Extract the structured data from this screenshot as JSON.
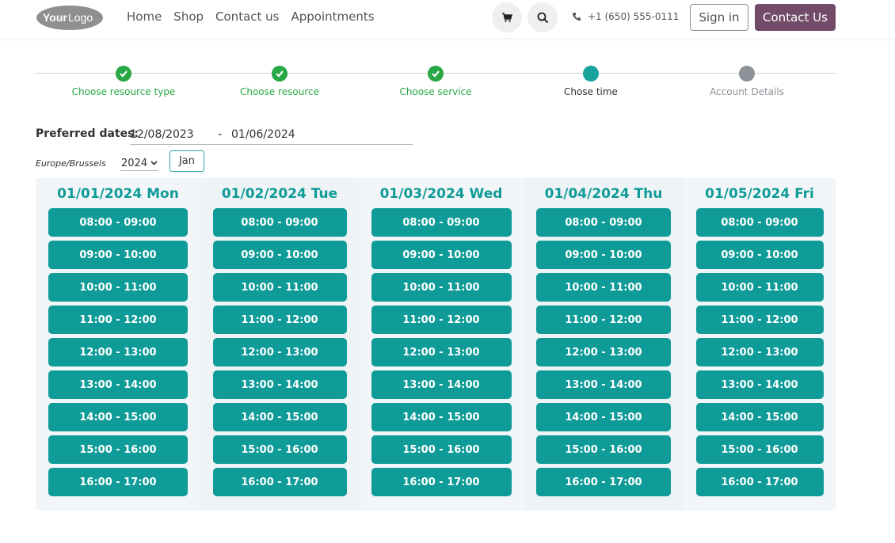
{
  "colors": {
    "accent": "#0f9b97",
    "brand": "#714b67",
    "done": "#28a745",
    "current": "#17a29c",
    "pending": "#8c9298",
    "title_teal": "#0f9b97"
  },
  "header": {
    "logo_text": "YourLogo",
    "nav": [
      "Home",
      "Shop",
      "Contact us",
      "Appointments"
    ],
    "cart_icon": "cart-icon",
    "search_icon": "search-icon",
    "phone_icon": "phone-icon",
    "phone": "+1 (650) 555-0111",
    "signin_label": "Sign in",
    "contact_label": "Contact Us"
  },
  "progress": {
    "steps": [
      {
        "label": "Choose resource type",
        "state": "done"
      },
      {
        "label": "Choose resource",
        "state": "done"
      },
      {
        "label": "Choose service",
        "state": "done"
      },
      {
        "label": "Chose time",
        "state": "current"
      },
      {
        "label": "Account Details",
        "state": "pending"
      }
    ]
  },
  "filters": {
    "preferred_label": "Preferred dates:",
    "date_from": "12/08/2023",
    "dash": "-",
    "date_to": "01/06/2024",
    "timezone": "Europe/Brussels",
    "year": "2024",
    "month": "Jan"
  },
  "calendar": {
    "days": [
      {
        "title": "01/01/2024 Mon",
        "slots": [
          "08:00 - 09:00",
          "09:00 - 10:00",
          "10:00 - 11:00",
          "11:00 - 12:00",
          "12:00 - 13:00",
          "13:00 - 14:00",
          "14:00 - 15:00",
          "15:00 - 16:00",
          "16:00 - 17:00"
        ]
      },
      {
        "title": "01/02/2024 Tue",
        "slots": [
          "08:00 - 09:00",
          "09:00 - 10:00",
          "10:00 - 11:00",
          "11:00 - 12:00",
          "12:00 - 13:00",
          "13:00 - 14:00",
          "14:00 - 15:00",
          "15:00 - 16:00",
          "16:00 - 17:00"
        ]
      },
      {
        "title": "01/03/2024 Wed",
        "slots": [
          "08:00 - 09:00",
          "09:00 - 10:00",
          "10:00 - 11:00",
          "11:00 - 12:00",
          "12:00 - 13:00",
          "13:00 - 14:00",
          "14:00 - 15:00",
          "15:00 - 16:00",
          "16:00 - 17:00"
        ]
      },
      {
        "title": "01/04/2024 Thu",
        "slots": [
          "08:00 - 09:00",
          "09:00 - 10:00",
          "10:00 - 11:00",
          "11:00 - 12:00",
          "12:00 - 13:00",
          "13:00 - 14:00",
          "14:00 - 15:00",
          "15:00 - 16:00",
          "16:00 - 17:00"
        ]
      },
      {
        "title": "01/05/2024 Fri",
        "slots": [
          "08:00 - 09:00",
          "09:00 - 10:00",
          "10:00 - 11:00",
          "11:00 - 12:00",
          "12:00 - 13:00",
          "13:00 - 14:00",
          "14:00 - 15:00",
          "15:00 - 16:00",
          "16:00 - 17:00"
        ]
      }
    ]
  }
}
